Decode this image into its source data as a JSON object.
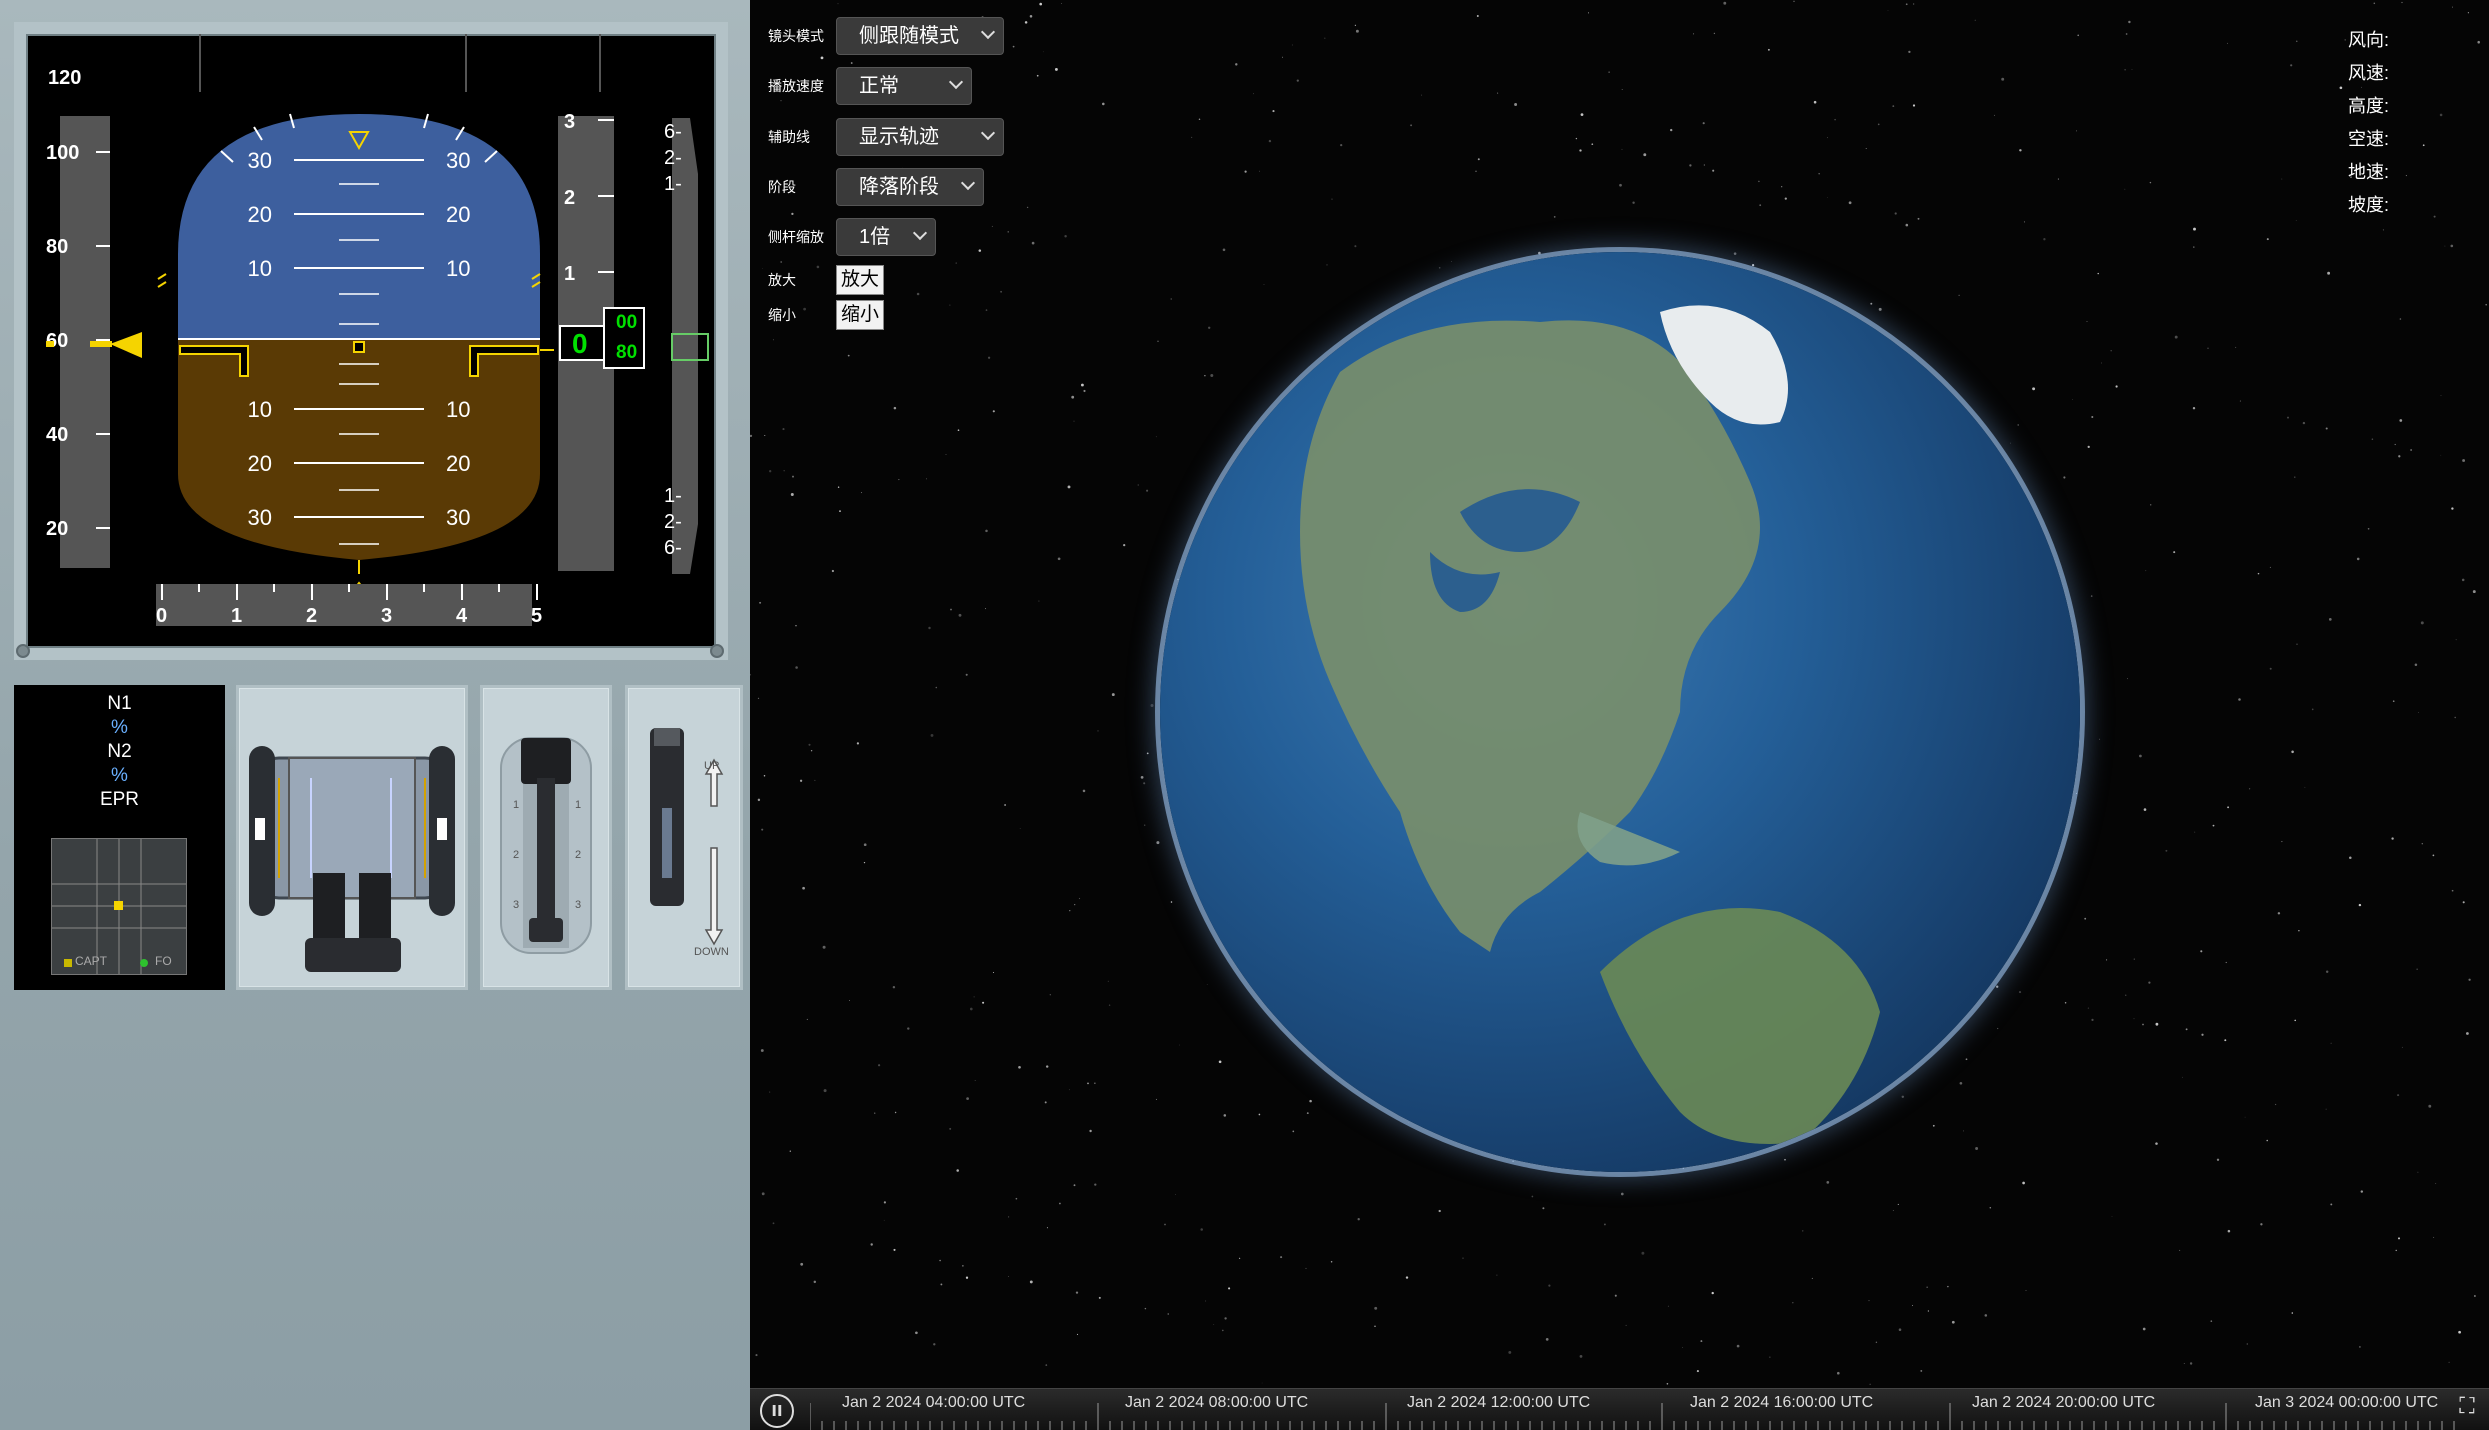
{
  "pfd": {
    "speed_ticks": [
      "100",
      "80",
      "60",
      "40",
      "20"
    ],
    "speed_top_partial": "120",
    "current_speed": "60",
    "pitch_up": [
      "30",
      "20",
      "10"
    ],
    "pitch_down": [
      "10",
      "20",
      "30"
    ],
    "alt_ticks": [
      "3",
      "2",
      "1"
    ],
    "altitude_main": "0",
    "altitude_roll_top": "00",
    "altitude_roll_bottom": "80",
    "vs_ticks_up": [
      "6",
      "2",
      "1"
    ],
    "vs_ticks_down": [
      "1",
      "2",
      "6"
    ],
    "heading_ticks": [
      "0",
      "1",
      "2",
      "3",
      "4",
      "5"
    ],
    "colors": {
      "sky": "#3d5f9e",
      "ground": "#5a3a05",
      "symbol": "#f5d400",
      "readout": "#00e000"
    }
  },
  "engine": {
    "labels": [
      "N1",
      "%",
      "N2",
      "%",
      "EPR"
    ],
    "legend_capt": "CAPT",
    "legend_fo": "FO"
  },
  "flap_lever": {
    "up": "UP",
    "down": "DOWN"
  },
  "controls": [
    {
      "label": "镜头模式",
      "value": "侧跟随模式"
    },
    {
      "label": "播放速度",
      "value": "正常"
    },
    {
      "label": "辅助线",
      "value": "显示轨迹"
    },
    {
      "label": "阶段",
      "value": "降落阶段"
    },
    {
      "label": "侧杆缩放",
      "value": "1倍"
    }
  ],
  "zoom": {
    "in_label": "放大",
    "in_button": "放大",
    "out_label": "缩小",
    "out_button": "缩小"
  },
  "readouts": [
    "风向:",
    "风速:",
    "高度:",
    "空速:",
    "地速:",
    "坡度:"
  ],
  "timeline": {
    "labels": [
      "Jan 2 2024 04:00:00 UTC",
      "Jan 2 2024 08:00:00 UTC",
      "Jan 2 2024 12:00:00 UTC",
      "Jan 2 2024 16:00:00 UTC",
      "Jan 2 2024 20:00:00 UTC",
      "Jan 3 2024 00:00:00 UTC"
    ],
    "play_icon": "pause-icon",
    "fullscreen_icon": "fullscreen-icon"
  }
}
